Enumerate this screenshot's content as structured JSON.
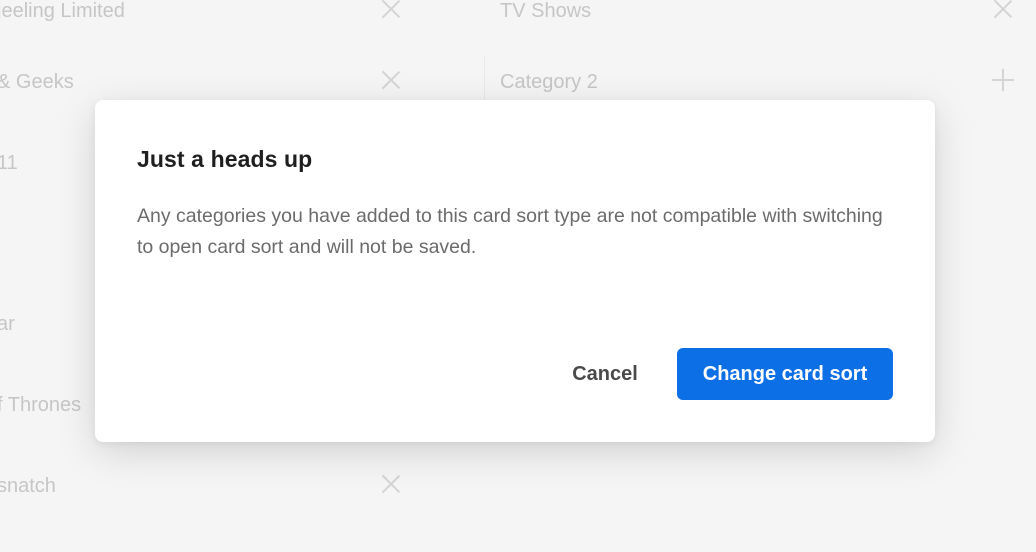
{
  "background": {
    "left_column": {
      "items": [
        {
          "label": "jeeling Limited"
        },
        {
          "label": "& Geeks"
        },
        {
          "label": "11"
        },
        {
          "label": "ar"
        },
        {
          "label": "f Thrones"
        },
        {
          "label": "snatch"
        }
      ]
    },
    "right_column": {
      "items": [
        {
          "label": "TV Shows"
        },
        {
          "placeholder": "Category 2"
        }
      ]
    }
  },
  "modal": {
    "title": "Just a heads up",
    "body": "Any categories you have added to this card sort type are not compatible with switching to open card sort and will not be saved.",
    "cancel_label": "Cancel",
    "confirm_label": "Change card sort"
  },
  "colors": {
    "primary": "#0d6fe6",
    "overlay_bg": "#f5f5f5"
  }
}
